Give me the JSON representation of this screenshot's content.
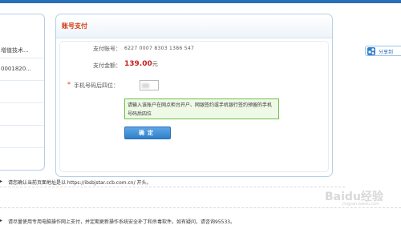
{
  "order_panel": {
    "rows": [
      {
        "text": "增值技术..."
      },
      {
        "text": "0001820..."
      }
    ]
  },
  "payment": {
    "title": "账号支付",
    "account_label": "支付账号：",
    "account_value": "6227 0007 8303 1386 547",
    "amount_label": "支付金额：",
    "amount_value": "139.00",
    "amount_unit": "元",
    "required_mark": "*",
    "phone_label": "手机号码后四位：",
    "phone_value": "",
    "tooltip": "请输入该账户在网点柜台开户、网银签约或手机银行签约预留的手机号码后四位",
    "confirm_label": "确定"
  },
  "share": {
    "label": "分享到"
  },
  "notices": [
    {
      "bullet": "▸",
      "text": "请您确认当前页面地址是以 https://ibsbjstar.ccb.com.cn/ 开头。"
    },
    {
      "bullet": "▸",
      "text": "请尽量使用专用电脑操作网上支付，并定期更新操作系统安全补丁和杀毒软件。如有疑问，请咨询95533。"
    }
  ],
  "watermark": {
    "brand": "Baidu经验",
    "sub": "jingyan.baidu.com"
  },
  "colors": {
    "accent": "#2a6fb8",
    "title_red": "#d23a10",
    "amount_red": "#c8201a",
    "tooltip_border": "#6fbf4a"
  }
}
